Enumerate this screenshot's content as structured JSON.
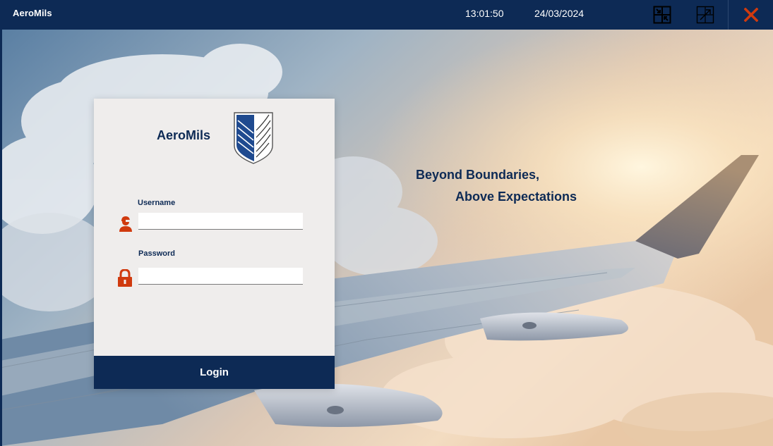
{
  "titlebar": {
    "app_name": "AeroMils",
    "time": "13:01:50",
    "date": "24/03/2024",
    "icons": {
      "restore": "restore-window-icon",
      "maximize": "maximize-icon",
      "close": "close-icon"
    }
  },
  "login": {
    "brand": "AeroMils",
    "username_label": "Username",
    "username_value": "",
    "password_label": "Password",
    "password_value": "",
    "button_label": "Login",
    "icons": {
      "username": "user-icon",
      "password": "lock-icon",
      "logo": "wings-emblem-logo"
    }
  },
  "tagline": {
    "line1": "Beyond Boundaries,",
    "line2": "Above Expectations"
  },
  "colors": {
    "navy": "#0d2a55",
    "accent_orange": "#d03a0e",
    "card_bg": "#efedec"
  }
}
